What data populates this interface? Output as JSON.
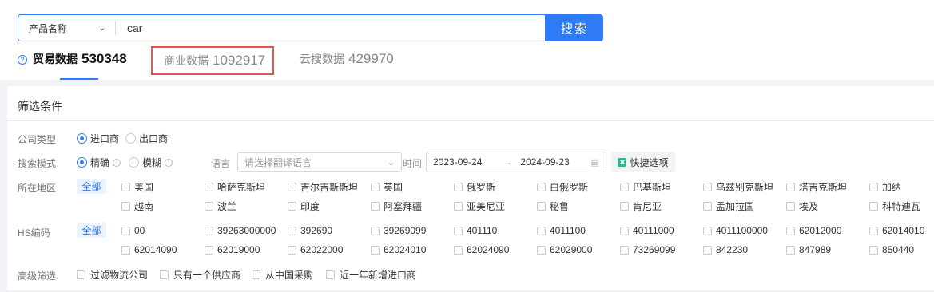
{
  "search": {
    "field_select": "产品名称",
    "query": "car",
    "button_label": "搜索"
  },
  "tabs": [
    {
      "label": "贸易数据",
      "count": "530348"
    },
    {
      "label": "商业数据",
      "count": "1092917"
    },
    {
      "label": "云搜数据",
      "count": "429970"
    }
  ],
  "filters": {
    "title": "筛选条件",
    "company_type": {
      "label": "公司类型",
      "options": [
        "进口商",
        "出口商"
      ],
      "selected": "进口商"
    },
    "search_mode": {
      "label": "搜索模式",
      "options": [
        "精确",
        "模糊"
      ],
      "selected": "精确"
    },
    "language": {
      "label": "语言",
      "placeholder": "请选择翻译语言"
    },
    "time": {
      "label": "时间",
      "start": "2023-09-24",
      "end": "2024-09-23"
    },
    "quick_options_label": "快捷选项",
    "region": {
      "label": "所在地区",
      "all_label": "全部",
      "options": [
        "美国",
        "哈萨克斯坦",
        "吉尔吉斯斯坦",
        "英国",
        "俄罗斯",
        "白俄罗斯",
        "巴基斯坦",
        "乌兹别克斯坦",
        "塔吉克斯坦",
        "加纳",
        "越南",
        "波兰",
        "印度",
        "阿塞拜疆",
        "亚美尼亚",
        "秘鲁",
        "肯尼亚",
        "孟加拉国",
        "埃及",
        "科特迪瓦"
      ]
    },
    "hs_code": {
      "label": "HS编码",
      "all_label": "全部",
      "options": [
        "00",
        "39263000000",
        "392690",
        "39269099",
        "401110",
        "4011100",
        "40111000",
        "4011100000",
        "62012000",
        "62014010",
        "62014090",
        "62019000",
        "62022000",
        "62024010",
        "62024090",
        "62029000",
        "73269099",
        "842230",
        "847989",
        "850440"
      ]
    },
    "advanced": {
      "label": "高级筛选",
      "options": [
        "过滤物流公司",
        "只有一个供应商",
        "从中国采购",
        "近一年新增进口商"
      ]
    }
  },
  "colors": {
    "accent": "#2f7bf5",
    "highlight_border": "#e05a53",
    "quick_icon": "#33b38c"
  }
}
